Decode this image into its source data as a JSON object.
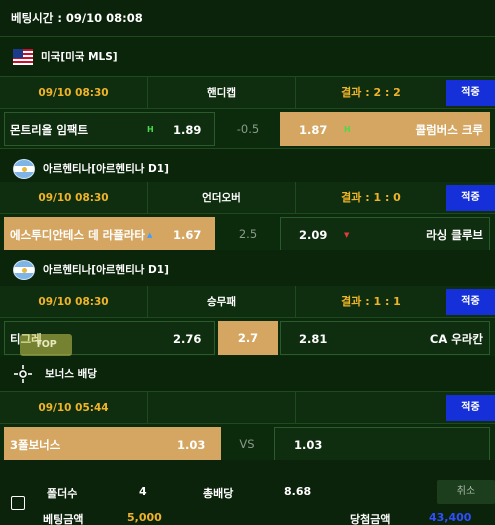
{
  "bet_time": "베팅시간 : 09/10 08:08",
  "accent": {
    "gold": "#f0b429",
    "hit_blue": "#1530d8",
    "selected": "#d4a662"
  },
  "games": [
    {
      "league": "미국[미국 MLS]",
      "flag_icon": "usa-flag-icon",
      "time": "09/10 08:30",
      "type": "핸디캡",
      "result": "결과 : 2 : 2",
      "status": "적중",
      "home": "몬트리올 임팩트",
      "home_mark": "H",
      "home_odds": "1.89",
      "mid": "-0.5",
      "away_odds": "1.87",
      "away_mark": "H",
      "away": "콜럼버스 크루"
    },
    {
      "league": "아르헨티나[아르헨티나 D1]",
      "flag_icon": "argentina-flag-icon",
      "time": "09/10 08:30",
      "type": "언더오버",
      "result": "결과 : 1 : 0",
      "status": "적중",
      "home": "에스투디안테스 데 라플라타",
      "home_odds": "1.67",
      "mid": "2.5",
      "away_odds": "2.09",
      "away": "라싱 클루브"
    },
    {
      "league": "아르헨티나[아르헨티나 D1]",
      "flag_icon": "argentina-flag-icon",
      "time": "09/10 08:30",
      "type": "승무패",
      "result": "결과 : 1 : 1",
      "status": "적중",
      "home": "티그레",
      "home_odds": "2.76",
      "mid": "2.7",
      "away_odds": "2.81",
      "away": "CA 우라칸"
    },
    {
      "league": "보너스 배당",
      "flag_icon": "bonus-icon",
      "time": "09/10 05:44",
      "type": "",
      "result": "",
      "status": "적중",
      "home": "3폴보너스",
      "home_odds": "1.03",
      "mid": "VS",
      "away_odds": "1.03",
      "away": ""
    }
  ],
  "top_button": "TOP",
  "summary": {
    "folder_label": "폴더수",
    "folder_value": "4",
    "total_odds_label": "총배당",
    "total_odds_value": "8.68",
    "bet_amount_label": "베팅금액",
    "bet_amount_value": "5,000",
    "win_amount_label": "당첨금액",
    "win_amount_value": "43,400",
    "cancel_label": "취소"
  }
}
